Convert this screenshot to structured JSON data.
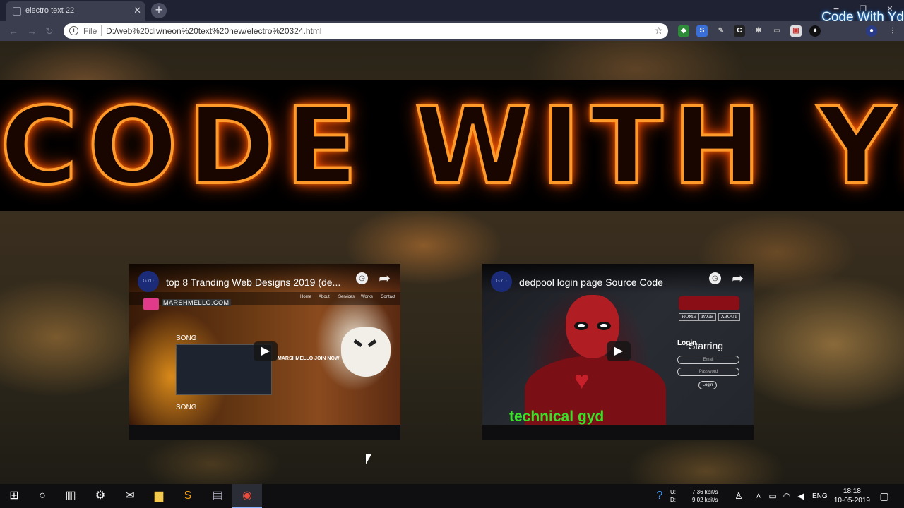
{
  "browser": {
    "tab_title": "electro text 22",
    "tab_close": "✕",
    "new_tab": "+",
    "scheme": "File",
    "url": "D:/web%20div/neon%20text%20new/electro%20324.html",
    "watermark": "Code With Yd"
  },
  "page": {
    "banner_text": "CODE WITH YD",
    "videos": [
      {
        "title": "top 8 Tranding Web Designs 2019 (de...",
        "logo": "MARSHMELLO.COM",
        "nav": [
          "Home",
          "About",
          "Services",
          "Works",
          "Contact"
        ],
        "song1": "SONG",
        "song2": "SONG",
        "join": "MARSHMELLO JOIN NOW"
      },
      {
        "title": "dedpool login page Source Code",
        "menu": [
          "HOME",
          "PAGE",
          "ABOUT"
        ],
        "login_label": "Login",
        "starring": "Starring",
        "email_placeholder": "Email",
        "password_placeholder": "Password",
        "login_button": "Login",
        "overlay_text": "technical gyd"
      }
    ]
  },
  "taskbar": {
    "net_up": "7.36 kbit/s",
    "net_down": "9.02 kbit/s",
    "net_u": "U:",
    "net_d": "D:",
    "lang": "ENG",
    "time": "18:18",
    "date": "10-05-2019"
  },
  "colors": {
    "neon_stroke": "#ff9a2a",
    "neon_glow": "#ff5a00",
    "overlay_green": "#3ae02a",
    "taskbar_bg": "#0f0f12"
  }
}
